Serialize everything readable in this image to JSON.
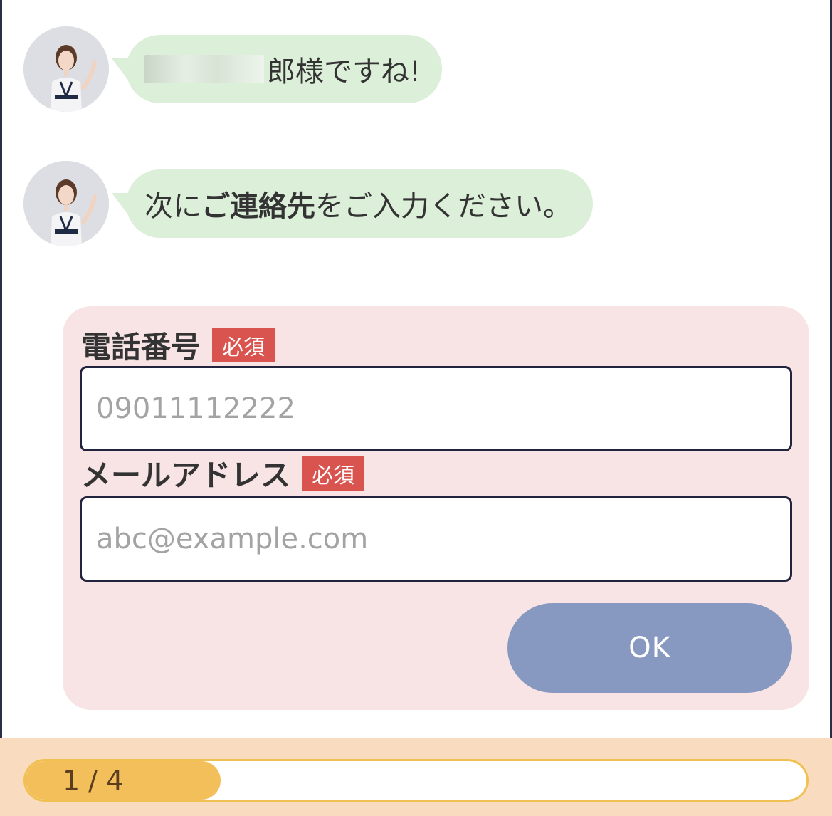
{
  "chat": {
    "messages": [
      {
        "text_visible": "郎様ですね!",
        "redacted_prefix": true
      },
      {
        "parts": [
          "次に",
          "ご連絡先",
          "をご入力ください。"
        ]
      }
    ]
  },
  "form": {
    "phone": {
      "label": "電話番号",
      "badge": "必須",
      "placeholder": "09011112222",
      "value": ""
    },
    "email": {
      "label": "メールアドレス",
      "badge": "必須",
      "placeholder": "abc@example.com",
      "value": ""
    },
    "submit_label": "OK"
  },
  "progress": {
    "label": "1 / 4",
    "current": 1,
    "total": 4,
    "fill_fraction": 0.25
  },
  "colors": {
    "bubble": "#dcefd9",
    "form_bg": "#f8e4e4",
    "badge": "#d9534f",
    "ok_button": "#8899c1",
    "progress_fill": "#f3bf5b",
    "footer_bg": "#f9dcbf"
  },
  "icons": {
    "avatar": "operator-avatar-icon"
  }
}
